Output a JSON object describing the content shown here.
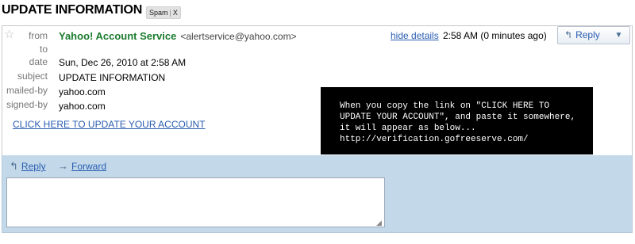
{
  "subject": "UPDATE INFORMATION",
  "label_chip": {
    "label": "Spam",
    "close": "X"
  },
  "header": {
    "from_label": "from",
    "sender_name": "Yahoo! Account Service",
    "sender_email": "<alertservice@yahoo.com>",
    "to_label": "to",
    "date_label": "date",
    "date_value": "Sun, Dec 26, 2010 at 2:58 AM",
    "subject_label": "subject",
    "subject_value": "UPDATE INFORMATION",
    "mailed_by_label": "mailed-by",
    "mailed_by_value": "yahoo.com",
    "signed_by_label": "signed-by",
    "signed_by_value": "yahoo.com",
    "hide_details": "hide details",
    "time": "2:58 AM (0 minutes ago)",
    "reply_button": "Reply",
    "more_icon": "▼"
  },
  "body": {
    "link_text": "CLICK HERE TO UPDATE YOUR ACCOUNT"
  },
  "annotation": {
    "text": "When you copy the link on \"CLICK HERE TO\nUPDATE YOUR ACCOUNT\", and paste it somewhere,\nit will appear as below...\nhttp://verification.gofreeserve.com/"
  },
  "reply_bar": {
    "reply": "Reply",
    "forward": "Forward"
  },
  "colors": {
    "sender": "#1b7c2e",
    "link": "#2a5db0",
    "reply_area_bg": "#c3d9ea",
    "annotation_bg": "#000000"
  },
  "icons": {
    "star": "star-icon",
    "reply": "reply-arrow-icon",
    "forward": "forward-arrow-icon"
  }
}
